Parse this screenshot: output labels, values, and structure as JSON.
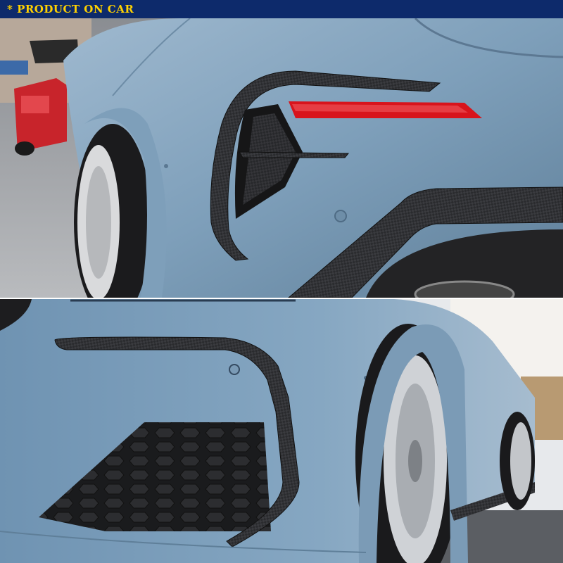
{
  "banner": {
    "text": "* PRODUCT ON CAR",
    "background_color": "#0d2a6b",
    "text_color": "#ffd200"
  },
  "colors": {
    "car_paint": "#86a7c2",
    "carbon_fiber": "#2b2b2d",
    "tail_light": "#d8141c"
  }
}
